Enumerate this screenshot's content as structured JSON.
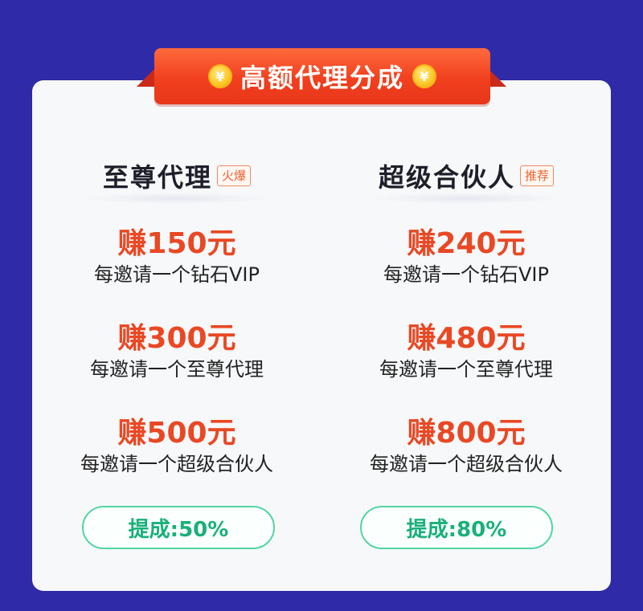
{
  "banner": {
    "title": "高额代理分成",
    "coin_symbol": "¥"
  },
  "columns": [
    {
      "title": "至尊代理",
      "tag": "火爆",
      "tiers": [
        {
          "amount": "赚150元",
          "desc": "每邀请一个钻石VIP"
        },
        {
          "amount": "赚300元",
          "desc": "每邀请一个至尊代理"
        },
        {
          "amount": "赚500元",
          "desc": "每邀请一个超级合伙人"
        }
      ],
      "rate": "提成:50%"
    },
    {
      "title": "超级合伙人",
      "tag": "推荐",
      "tiers": [
        {
          "amount": "赚240元",
          "desc": "每邀请一个钻石VIP"
        },
        {
          "amount": "赚480元",
          "desc": "每邀请一个至尊代理"
        },
        {
          "amount": "赚800元",
          "desc": "每邀请一个超级合伙人"
        }
      ],
      "rate": "提成:80%"
    }
  ],
  "colors": {
    "background": "#2f2ba8",
    "banner": "#f0401f",
    "amount": "#e94824",
    "rate": "#19b07a"
  }
}
